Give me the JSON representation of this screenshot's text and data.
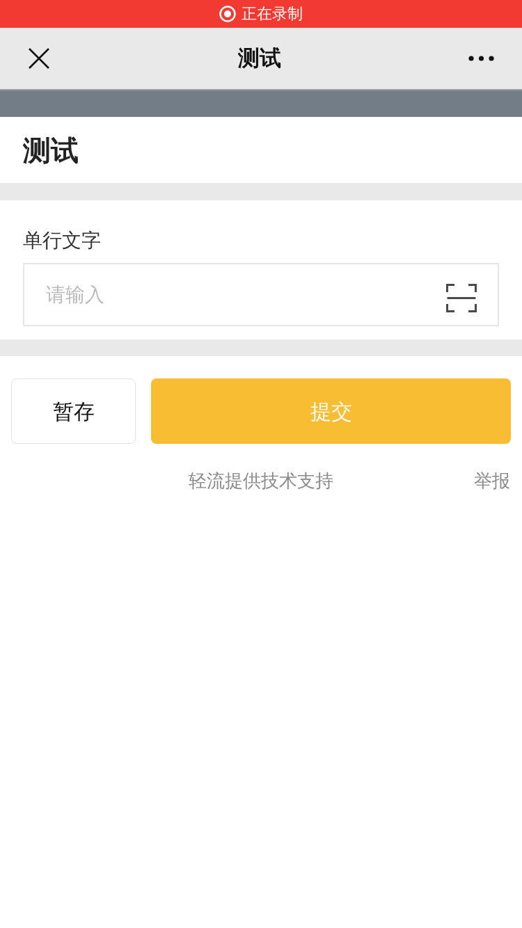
{
  "recording_bar": {
    "label": "正在录制"
  },
  "nav_bar": {
    "title": "测试"
  },
  "form": {
    "title": "测试",
    "fields": [
      {
        "kind": "text",
        "label": "单行文字",
        "placeholder": "请输入"
      }
    ]
  },
  "buttons": [
    {
      "kind": "secondary",
      "label": "暂存"
    },
    {
      "kind": "primary",
      "label": "提交"
    }
  ],
  "footer": {
    "credit": "轻流提供技术支持",
    "report": "举报"
  }
}
